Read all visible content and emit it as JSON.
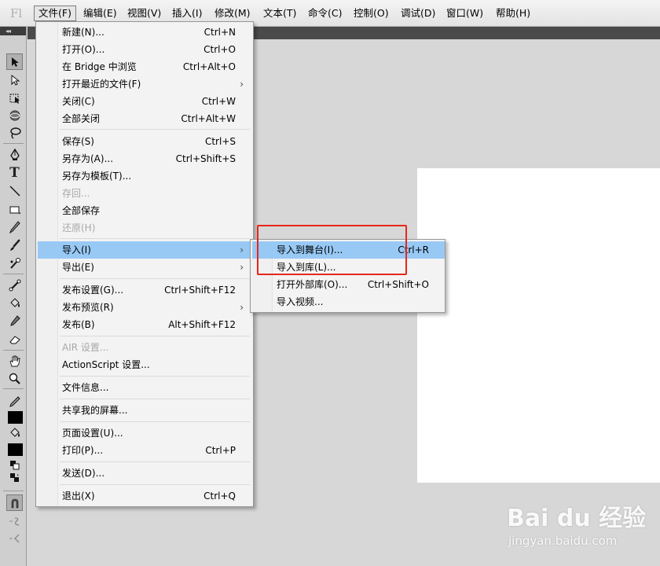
{
  "app": {
    "logo": "Fl"
  },
  "menubar": [
    {
      "label": "文件(F)",
      "active": true
    },
    {
      "label": "编辑(E)"
    },
    {
      "label": "视图(V)"
    },
    {
      "label": "插入(I)"
    },
    {
      "label": "修改(M)"
    },
    {
      "label": "文本(T)"
    },
    {
      "label": "命令(C)"
    },
    {
      "label": "控制(O)"
    },
    {
      "label": "调试(D)"
    },
    {
      "label": "窗口(W)"
    },
    {
      "label": "帮助(H)"
    }
  ],
  "toolbar": {
    "collapse_glyph": "◂◂",
    "tools": [
      "selection-tool",
      "subselection-tool",
      "free-transform-tool",
      "3d-rotation-tool",
      "lasso-tool",
      "pen-tool",
      "text-tool",
      "line-tool",
      "rectangle-tool",
      "pencil-tool",
      "brush-tool",
      "deco-tool",
      "bone-tool",
      "paint-bucket-tool",
      "eyedropper-tool",
      "eraser-tool",
      "hand-tool",
      "zoom-tool",
      "stroke-color",
      "fill-color",
      "swap-colors",
      "snap-to-objects",
      "smooth",
      "straighten"
    ],
    "text_tool_glyph": "T"
  },
  "file_menu": {
    "items": [
      {
        "label": "新建(N)...",
        "shortcut": "Ctrl+N"
      },
      {
        "label": "打开(O)...",
        "shortcut": "Ctrl+O"
      },
      {
        "label": "在 Bridge 中浏览",
        "shortcut": "Ctrl+Alt+O"
      },
      {
        "label": "打开最近的文件(F)",
        "shortcut": "",
        "submenu": true
      },
      {
        "label": "关闭(C)",
        "shortcut": "Ctrl+W"
      },
      {
        "label": "全部关闭",
        "shortcut": "Ctrl+Alt+W"
      },
      {
        "label": "保存(S)",
        "shortcut": "Ctrl+S"
      },
      {
        "label": "另存为(A)...",
        "shortcut": "Ctrl+Shift+S"
      },
      {
        "label": "另存为模板(T)...",
        "shortcut": ""
      },
      {
        "label": "存回...",
        "shortcut": "",
        "disabled": true
      },
      {
        "label": "全部保存",
        "shortcut": ""
      },
      {
        "label": "还原(H)",
        "shortcut": "",
        "disabled": true
      },
      {
        "label": "导入(I)",
        "shortcut": "",
        "submenu": true,
        "highlight": true
      },
      {
        "label": "导出(E)",
        "shortcut": "",
        "submenu": true
      },
      {
        "label": "发布设置(G)...",
        "shortcut": "Ctrl+Shift+F12"
      },
      {
        "label": "发布预览(R)",
        "shortcut": "",
        "submenu": true
      },
      {
        "label": "发布(B)",
        "shortcut": "Alt+Shift+F12"
      },
      {
        "label": "AIR 设置...",
        "shortcut": "",
        "disabled": true
      },
      {
        "label": "ActionScript 设置...",
        "shortcut": ""
      },
      {
        "label": "文件信息...",
        "shortcut": ""
      },
      {
        "label": "共享我的屏幕...",
        "shortcut": ""
      },
      {
        "label": "页面设置(U)...",
        "shortcut": ""
      },
      {
        "label": "打印(P)...",
        "shortcut": "Ctrl+P"
      },
      {
        "label": "发送(D)...",
        "shortcut": ""
      },
      {
        "label": "退出(X)",
        "shortcut": "Ctrl+Q"
      }
    ],
    "submenu_arrow": "›"
  },
  "import_submenu": {
    "items": [
      {
        "label": "导入到舞台(I)...",
        "shortcut": "Ctrl+R",
        "highlight": true
      },
      {
        "label": "导入到库(L)...",
        "shortcut": ""
      },
      {
        "label": "打开外部库(O)...",
        "shortcut": "Ctrl+Shift+O"
      },
      {
        "label": "导入视频...",
        "shortcut": ""
      }
    ]
  },
  "annotation": {
    "color": "#e8261a"
  },
  "watermark": {
    "brand": "Bai du 经验",
    "url": "jingyan.baidu.com"
  }
}
